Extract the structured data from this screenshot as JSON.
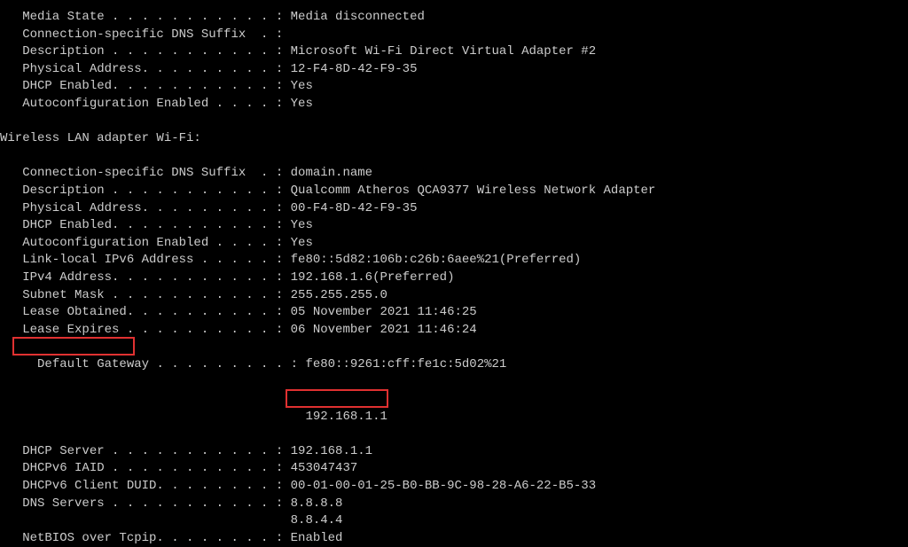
{
  "adapter1": {
    "media_state": "   Media State . . . . . . . . . . . : Media disconnected",
    "dns_suffix": "   Connection-specific DNS Suffix  . :",
    "description": "   Description . . . . . . . . . . . : Microsoft Wi-Fi Direct Virtual Adapter #2",
    "physical_address": "   Physical Address. . . . . . . . . : 12-F4-8D-42-F9-35",
    "dhcp_enabled": "   DHCP Enabled. . . . . . . . . . . : Yes",
    "autoconfig": "   Autoconfiguration Enabled . . . . : Yes"
  },
  "adapter2_header": "Wireless LAN adapter Wi-Fi:",
  "adapter2": {
    "dns_suffix": "   Connection-specific DNS Suffix  . : domain.name",
    "description": "   Description . . . . . . . . . . . : Qualcomm Atheros QCA9377 Wireless Network Adapter",
    "physical_address": "   Physical Address. . . . . . . . . : 00-F4-8D-42-F9-35",
    "dhcp_enabled": "   DHCP Enabled. . . . . . . . . . . : Yes",
    "autoconfig": "   Autoconfiguration Enabled . . . . : Yes",
    "link_local_ipv6": "   Link-local IPv6 Address . . . . . : fe80::5d82:106b:c26b:6aee%21(Preferred)",
    "ipv4_address": "   IPv4 Address. . . . . . . . . . . : 192.168.1.6(Preferred)",
    "subnet_mask": "   Subnet Mask . . . . . . . . . . . : 255.255.255.0",
    "lease_obtained": "   Lease Obtained. . . . . . . . . . : 05 November 2021 11:46:25",
    "lease_expires": "   Lease Expires . . . . . . . . . . : 06 November 2021 11:46:24",
    "default_gateway": "   Default Gateway . . . . . . . . . : fe80::9261:cff:fe1c:5d02%21",
    "default_gateway2": "                                       192.168.1.1",
    "dhcp_server": "   DHCP Server . . . . . . . . . . . : 192.168.1.1",
    "dhcpv6_iaid": "   DHCPv6 IAID . . . . . . . . . . . : 453047437",
    "dhcpv6_client_duid": "   DHCPv6 Client DUID. . . . . . . . : 00-01-00-01-25-B0-BB-9C-98-28-A6-22-B5-33",
    "dns_servers": "   DNS Servers . . . . . . . . . . . : 8.8.8.8",
    "dns_servers2": "                                       8.8.4.4",
    "netbios": "   NetBIOS over Tcpip. . . . . . . . : Enabled"
  }
}
